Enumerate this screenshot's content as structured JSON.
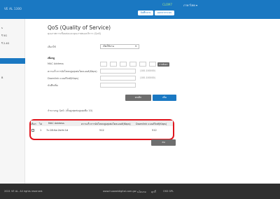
{
  "header": {
    "brand": "VE AL 1300",
    "user": "CLOM7",
    "lang": "ภาษาไทย ▾",
    "btn_save": "บันทึกงาน",
    "btn_logout": "ออกจากระบบ"
  },
  "sidebar": {
    "items": [
      {
        "label": "s"
      },
      {
        "label": "รี 5G"
      },
      {
        "label": "รี 2.4G"
      },
      {
        "label": ""
      },
      {
        "label": "B"
      }
    ]
  },
  "page": {
    "title": "QoS (Quality of Service)",
    "subtitle": "คุณภาพการเชื่อมต่อและคุณภาพของบริการ (QoS)"
  },
  "form": {
    "mode_label": "เลือกใช้",
    "mode_value": "เปิดใช้งาน",
    "add_label": "เพิ่มกฎ",
    "mac_label": "MAC Address",
    "mac_button": "การค้นหา",
    "up_label": "ความเร็วการอัปโหลดสูงสุดต่อไคลเอนต์(Kbps)",
    "up_hint": "(100-100000)",
    "down_label": "Downlink แบนด์วิดท์(Kbps)",
    "down_hint": "(100-100000)",
    "remark_label": "บันทึกเพิ่ม"
  },
  "actions": {
    "cancel": "ยกเลิก",
    "add": "เพิ่ม"
  },
  "rules": {
    "caption": "จำนวนกฎ QoS: (ขั้นสูงสุดต่อสูงสุดคือ 10)",
    "headers": [
      "เลือก",
      "ไม่",
      "MAC Address",
      "ความเร็วการอัปโหลดสูงสุดต่อไคลเอนต์(Kbps)",
      "Downlink แบนด์วิดท์(Kbps)"
    ],
    "rows": [
      {
        "no": "1",
        "mac": "7c:28:0a:2b:fe:1d",
        "up": "512",
        "down": "512"
      }
    ],
    "delete": "ลบ"
  },
  "footer": {
    "copyright": "2021 VE AL. All rights reserved.",
    "site": "www.huaweidigital.com.gw",
    "links": [
      "นโยบาย",
      "คุกกี้",
      "OSS GPL"
    ]
  }
}
